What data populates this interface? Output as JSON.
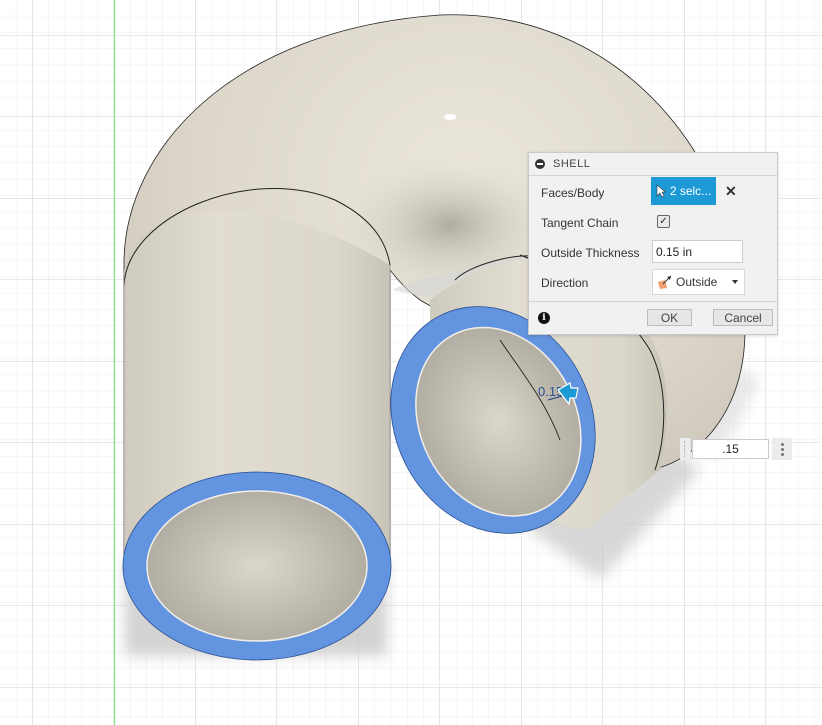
{
  "dialog": {
    "title": "SHELL",
    "faces_body_label": "Faces/Body",
    "faces_body_value": "2 selc...",
    "tangent_chain_label": "Tangent Chain",
    "tangent_chain_checked": true,
    "outside_thickness_label": "Outside Thickness",
    "outside_thickness_value": "0.15 in",
    "direction_label": "Direction",
    "direction_value": "Outside",
    "ok_label": "OK",
    "cancel_label": "Cancel",
    "check_glyph": "✓",
    "clear_glyph": "✕",
    "info_glyph": "i"
  },
  "viewport": {
    "inline_thickness_value": ".15",
    "manipulator_label": "0.15",
    "selection_color": "#6394e0",
    "body_color": "#ddd8cc",
    "axis_color": "#7fe07f",
    "accent_color": "#1d9ad6"
  }
}
